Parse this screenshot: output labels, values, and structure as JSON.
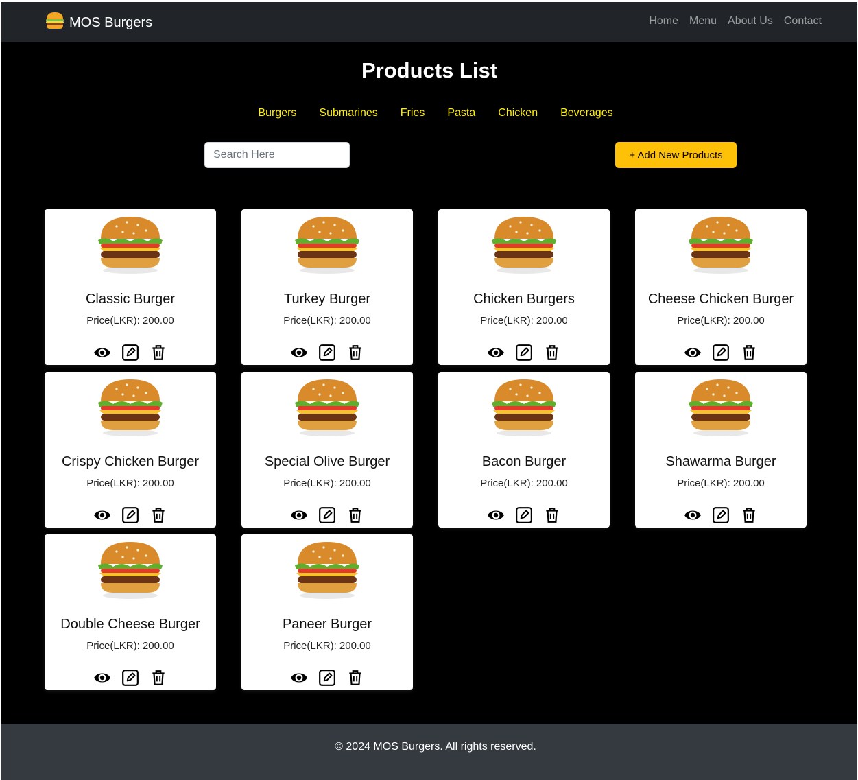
{
  "navbar": {
    "brand": "MOS Burgers",
    "brand_icon": "burger-icon",
    "links": [
      "Home",
      "Menu",
      "About Us",
      "Contact"
    ]
  },
  "page": {
    "title": "Products List",
    "categories": [
      "Burgers",
      "Submarines",
      "Fries",
      "Pasta",
      "Chicken",
      "Beverages"
    ],
    "search_placeholder": "Search Here",
    "add_button": "+ Add New Products"
  },
  "colors": {
    "background": "#000000",
    "navbar": "#212529",
    "footer": "#343a40",
    "category_text": "#ffee00",
    "accent_button": "#ffc107"
  },
  "products": [
    {
      "name": "Classic Burger",
      "price": "Price(LKR): 200.00"
    },
    {
      "name": "Turkey Burger",
      "price": "Price(LKR): 200.00"
    },
    {
      "name": "Chicken Burgers",
      "price": "Price(LKR): 200.00"
    },
    {
      "name": "Cheese Chicken Burger",
      "price": "Price(LKR): 200.00"
    },
    {
      "name": "Crispy Chicken Burger",
      "price": "Price(LKR): 200.00"
    },
    {
      "name": "Special Olive Burger",
      "price": "Price(LKR): 200.00"
    },
    {
      "name": "Bacon Burger",
      "price": "Price(LKR): 200.00"
    },
    {
      "name": "Shawarma Burger",
      "price": "Price(LKR): 200.00"
    },
    {
      "name": "Double Cheese Burger",
      "price": "Price(LKR): 200.00"
    },
    {
      "name": "Paneer Burger",
      "price": "Price(LKR): 200.00"
    }
  ],
  "card_actions": [
    "view-icon",
    "edit-icon",
    "delete-icon"
  ],
  "footer": {
    "text": "© 2024 MOS Burgers. All rights reserved."
  }
}
